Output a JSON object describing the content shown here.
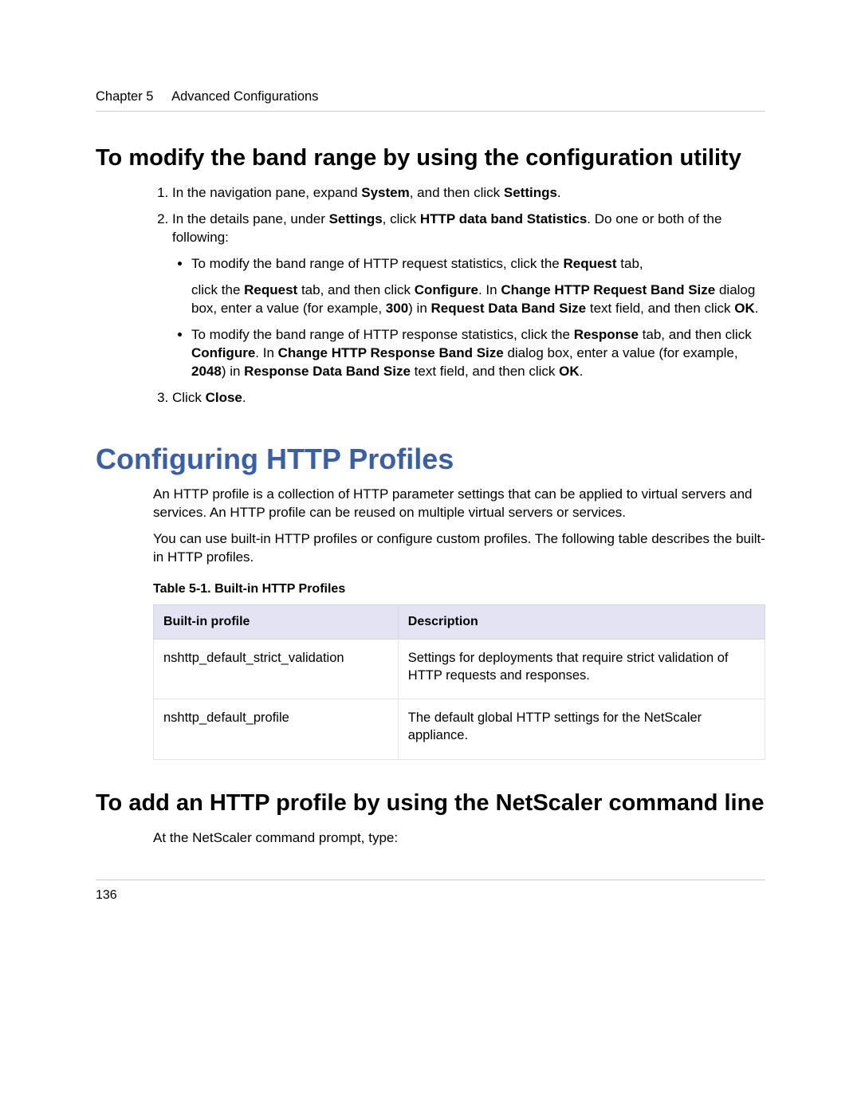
{
  "header": {
    "chapter": "Chapter 5",
    "title": "Advanced Configurations"
  },
  "section1": {
    "heading": "To modify the band range by using the configuration utility",
    "step1_a": "In the navigation pane, expand ",
    "step1_b": "System",
    "step1_c": ", and then click ",
    "step1_d": "Settings",
    "step1_e": ".",
    "step2_a": "In the details pane, under ",
    "step2_b": "Settings",
    "step2_c": ", click ",
    "step2_d": "HTTP data band Statistics",
    "step2_e": ". Do one or both of the following:",
    "bullet1_a": "To modify the band range of HTTP request statistics, click the ",
    "bullet1_b": "Request",
    "bullet1_c": " tab,",
    "bullet1p_a": "click the ",
    "bullet1p_b": "Request",
    "bullet1p_c": " tab, and then click ",
    "bullet1p_d": "Configure",
    "bullet1p_e": ". In ",
    "bullet1p_f": "Change HTTP Request Band Size",
    "bullet1p_g": " dialog box, enter a value (for example, ",
    "bullet1p_h": "300",
    "bullet1p_i": ") in ",
    "bullet1p_j": "Request Data Band Size",
    "bullet1p_k": " text field, and then click ",
    "bullet1p_l": "OK",
    "bullet1p_m": ".",
    "bullet2_a": "To modify the band range of HTTP response statistics, click the ",
    "bullet2_b": "Response",
    "bullet2_c": " tab, and then click ",
    "bullet2_d": "Configure",
    "bullet2_e": ". In ",
    "bullet2_f": "Change HTTP Response Band Size",
    "bullet2_g": " dialog box, enter a value (for example, ",
    "bullet2_h": "2048",
    "bullet2_i": ") in ",
    "bullet2_j": "Response Data Band Size",
    "bullet2_k": " text field, and then click ",
    "bullet2_l": "OK",
    "bullet2_m": ".",
    "step3_a": "Click ",
    "step3_b": "Close",
    "step3_c": "."
  },
  "topic": {
    "heading": "Configuring HTTP Profiles",
    "p1": "An HTTP profile is a collection of HTTP parameter settings that can be applied to virtual servers and services. An HTTP profile can be reused on multiple virtual servers or services.",
    "p2": "You can use built-in HTTP profiles or configure custom profiles. The following table describes the built-in HTTP profiles.",
    "table_caption": "Table 5-1. Built-in HTTP Profiles",
    "th1": "Built-in profile",
    "th2": "Description",
    "r1c1": "nshttp_default_strict_validation",
    "r1c2": "Settings for deployments that require strict validation of HTTP requests and responses.",
    "r2c1": "nshttp_default_profile",
    "r2c2": "The default global HTTP settings for the NetScaler appliance."
  },
  "section2": {
    "heading": "To add an HTTP profile by using the NetScaler command line",
    "p1": "At the NetScaler command prompt, type:"
  },
  "footer": {
    "page": "136"
  }
}
